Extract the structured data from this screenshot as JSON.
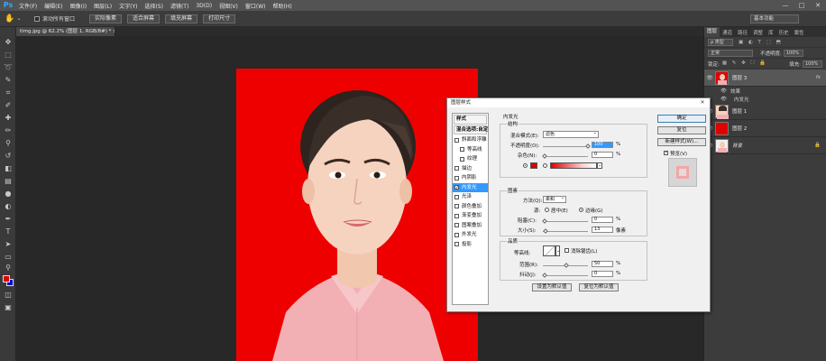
{
  "menubar": {
    "logo": "Ps",
    "items": [
      "文件(F)",
      "编辑(E)",
      "图像(I)",
      "图层(L)",
      "文字(Y)",
      "选择(S)",
      "滤镜(T)",
      "3D(D)",
      "视图(V)",
      "窗口(W)",
      "帮助(H)"
    ],
    "minimize": "—",
    "maximize": "□",
    "close": "✕"
  },
  "optbar": {
    "scroll_all": "滚动所有窗口",
    "buttons": [
      "实际像素",
      "适合屏幕",
      "填充屏幕",
      "打印尺寸"
    ],
    "workspace": "基本功能"
  },
  "document": {
    "tab": "timg.jpg @ 62.2% (图层 1, RGB/8#) *  ×"
  },
  "right_panel": {
    "tabs": [
      "图层",
      "通道",
      "路径",
      "调整",
      "库",
      "历史",
      "属性"
    ],
    "kind_filter": "ρ 类型",
    "blend_mode": "正常",
    "opacity_label": "不透明度:",
    "opacity_value": "100%",
    "lock_label": "锁定:",
    "fill_label": "填充:",
    "fill_value": "100%",
    "layers": [
      {
        "name": "图层 3",
        "fx": "fx",
        "selected": true
      },
      {
        "name": "图层 1",
        "fx": "",
        "selected": false
      },
      {
        "name": "图层 2",
        "fx": "",
        "selected": false
      },
      {
        "name": "背景",
        "fx": "",
        "selected": false
      }
    ],
    "effects_label": "效果",
    "effect_item": "内发光"
  },
  "dialog": {
    "title": "图层样式",
    "close": "✕",
    "styles": [
      {
        "label": "样式",
        "kind": "header"
      },
      {
        "label": "混合选项:自定",
        "kind": "header"
      },
      {
        "label": "斜面和浮雕",
        "kind": "item"
      },
      {
        "label": "等高线",
        "kind": "indent"
      },
      {
        "label": "纹理",
        "kind": "indent"
      },
      {
        "label": "描边",
        "kind": "item"
      },
      {
        "label": "内阴影",
        "kind": "item"
      },
      {
        "label": "内发光",
        "kind": "selected"
      },
      {
        "label": "光泽",
        "kind": "item"
      },
      {
        "label": "颜色叠加",
        "kind": "item"
      },
      {
        "label": "渐变叠加",
        "kind": "item"
      },
      {
        "label": "图案叠加",
        "kind": "item"
      },
      {
        "label": "外发光",
        "kind": "item"
      },
      {
        "label": "投影",
        "kind": "item"
      }
    ],
    "section_title": "内发光",
    "structure": {
      "title": "结构",
      "blend_label": "混合模式(E):",
      "blend_value": "滤色",
      "opacity_label": "不透明度(O):",
      "opacity_value": "100",
      "noise_label": "杂色(N):",
      "noise_value": "0",
      "pct": "%"
    },
    "elements": {
      "title": "图素",
      "method_label": "方法(Q):",
      "method_value": "柔和",
      "source_label": "源:",
      "center_label": "居中(E)",
      "edge_label": "边缘(G)",
      "choke_label": "阻塞(C):",
      "choke_value": "0",
      "size_label": "大小(S):",
      "size_value": "13",
      "px": "像素",
      "pct": "%"
    },
    "quality": {
      "title": "品质",
      "contour_label": "等高线:",
      "antialias_label": "消除锯齿(L)",
      "range_label": "范围(R):",
      "range_value": "50",
      "jitter_label": "抖动(J):",
      "jitter_value": "0",
      "pct": "%"
    },
    "make_default": "设置为默认值",
    "reset_default": "复位为默认值",
    "ok": "确定",
    "reset": "复位",
    "new_style": "新建样式(W)...",
    "preview_label": "预览(V)",
    "colors": {
      "glow": "#e00000"
    }
  }
}
